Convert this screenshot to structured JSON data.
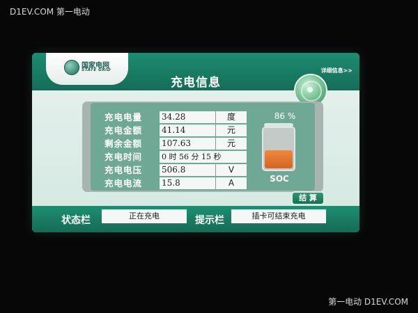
{
  "watermarks": {
    "top_left": "D1EV.COM 第一电动",
    "bottom_right": "第一电动 D1EV.COM"
  },
  "header": {
    "logo_cn": "国家电网",
    "logo_en": "STATE GRID",
    "title": "充电信息",
    "detail_link": "详细信息>>"
  },
  "info": {
    "rows": [
      {
        "label": "充电电量",
        "value": "34.28",
        "unit": "度"
      },
      {
        "label": "充电金额",
        "value": "41.14",
        "unit": "元"
      },
      {
        "label": "剩余金额",
        "value": "107.63",
        "unit": "元"
      },
      {
        "label": "充电电压",
        "value": "506.8",
        "unit": "V"
      },
      {
        "label": "充电电流",
        "value": "15.8",
        "unit": "A"
      }
    ],
    "time": {
      "label": "充电时间",
      "value": "0 时 56 分 15 秒"
    }
  },
  "battery": {
    "percent_text": "86 %",
    "level": 0.44,
    "soc_label": "SOC",
    "fill_color": "#e2742f"
  },
  "buttons": {
    "settle": "结 算"
  },
  "status": {
    "status_label": "状态栏",
    "status_value": "正在充电",
    "hint_label": "提示栏",
    "hint_value": "插卡可结束充电"
  },
  "colors": {
    "header_green": "#1a8466",
    "panel_green": "#6fa996"
  }
}
